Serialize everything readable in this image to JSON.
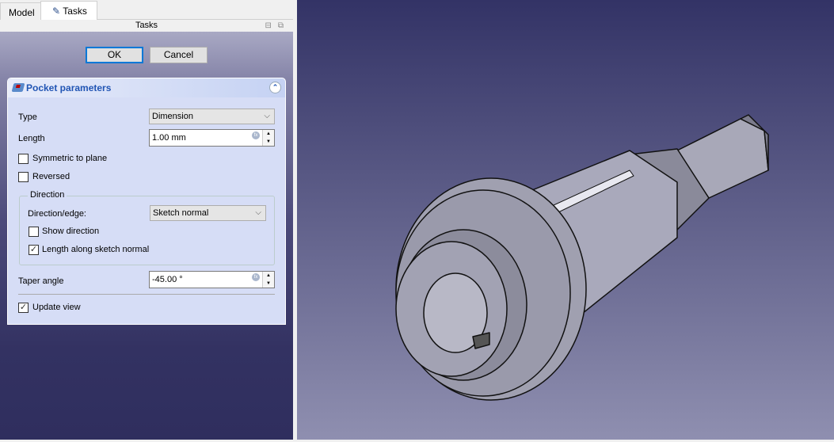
{
  "tabs": [
    {
      "label": "Model"
    },
    {
      "label": "Tasks"
    }
  ],
  "panel_title": "Tasks",
  "buttons": {
    "ok": "OK",
    "cancel": "Cancel"
  },
  "pocket": {
    "title": "Pocket parameters",
    "type_label": "Type",
    "type_value": "Dimension",
    "length_label": "Length",
    "length_value": "1.00 mm",
    "symmetric_label": "Symmetric to plane",
    "symmetric_checked": false,
    "reversed_label": "Reversed",
    "reversed_checked": false,
    "direction_group": "Direction",
    "direction_edge_label": "Direction/edge:",
    "direction_edge_value": "Sketch normal",
    "show_direction_label": "Show direction",
    "show_direction_checked": false,
    "length_along_label": "Length along sketch normal",
    "length_along_checked": true,
    "taper_label": "Taper angle",
    "taper_value": "-45.00 °",
    "update_view_label": "Update view",
    "update_view_checked": true
  },
  "colors": {
    "accent": "#0078d7",
    "header_text": "#2155b4",
    "panel_bg": "#d6ddf6"
  }
}
